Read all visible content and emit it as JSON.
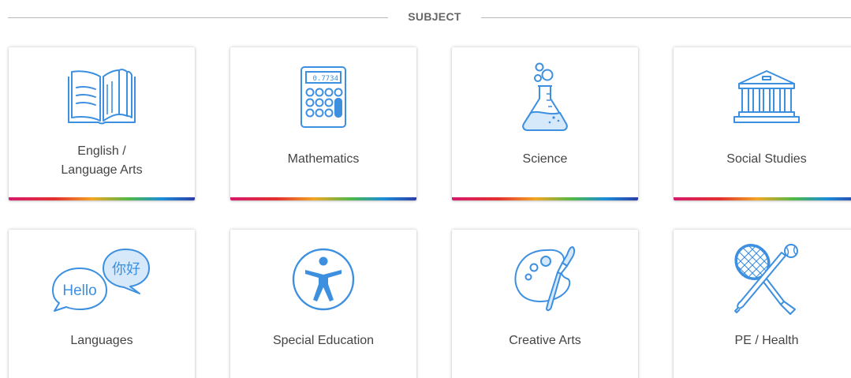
{
  "section": {
    "title": "SUBJECT"
  },
  "subjects": [
    {
      "label_line1": "English /",
      "label_line2": "Language Arts",
      "icon": "open-book-icon"
    },
    {
      "label": "Mathematics",
      "icon": "calculator-icon",
      "display": "0.7734"
    },
    {
      "label": "Science",
      "icon": "flask-icon"
    },
    {
      "label": "Social Studies",
      "icon": "government-building-icon"
    },
    {
      "label": "Languages",
      "icon": "speech-bubbles-icon",
      "bubble_left": "Hello",
      "bubble_right": "你好"
    },
    {
      "label": "Special Education",
      "icon": "accessibility-icon"
    },
    {
      "label": "Creative Arts",
      "icon": "paint-palette-icon"
    },
    {
      "label": "PE / Health",
      "icon": "sports-equipment-icon"
    }
  ],
  "colors": {
    "icon": "#3d8fe0",
    "icon_fill": "#d6e9fb",
    "rainbow": [
      "#d6196b",
      "#e3302f",
      "#f2a623",
      "#4db848",
      "#1c8fd8",
      "#2c3ea8"
    ]
  }
}
